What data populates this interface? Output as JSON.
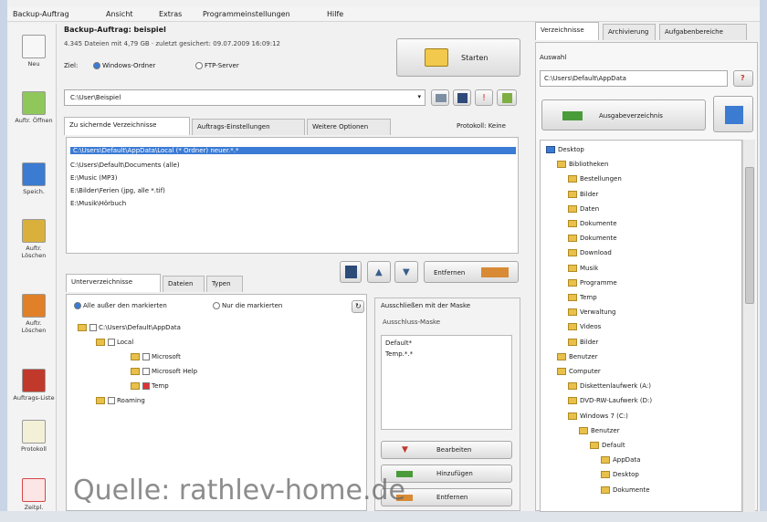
{
  "menu": [
    "Backup-Auftrag",
    "Ansicht",
    "Extras",
    "Programmeinstellungen",
    "Hilfe"
  ],
  "toolbar": [
    {
      "label": "Neu",
      "icon": "new-job-icon",
      "color": "#f2f2f2"
    },
    {
      "label": "Auftr. Öffnen",
      "icon": "open-job-icon",
      "color": "#8fc75b"
    },
    {
      "label": "Speich.",
      "icon": "save-job-icon",
      "color": "#3b7bd1"
    },
    {
      "label": "Auftr. Löschen",
      "icon": "delete-job-icon",
      "color": "#d9b03c"
    },
    {
      "label": "Auftr. Löschen",
      "icon": "remove-job-icon",
      "color": "#e0812a"
    },
    {
      "label": "Auftrags-Liste",
      "icon": "job-list-icon",
      "color": "#c0392b"
    },
    {
      "label": "Protokoll",
      "icon": "protocol-icon",
      "color": "#f4f0d8"
    },
    {
      "label": "Zeitpl.",
      "icon": "schedule-icon",
      "color": "#d8454a"
    }
  ],
  "job": {
    "title": "Backup-Auftrag: beispiel",
    "line2": "4.345 Dateien mit 4,79 GB  ·  zuletzt gesichert: 09.07.2009 16:09:12",
    "ziel_label": "Ziel:",
    "radio1": "Windows-Ordner",
    "radio2": "FTP-Server",
    "start_label": "Starten",
    "path_value": "C:\\User\\Beispiel"
  },
  "main_tabs": [
    "Zu sichernde Verzeichnisse",
    "Auftrags-Einstellungen",
    "Weitere Optionen"
  ],
  "protokoll_label": "Protokoll: Keine",
  "dir_list": [
    "C:\\Users\\Default\\AppData\\Local (* Ordner) neuer.*.*",
    "C:\\Users\\Default\\Documents (alle)",
    "E:\\Music (MP3)",
    "E:\\Bilder\\Ferien (jpg, alle *.tif)",
    "E:\\Musik\\Hörbuch"
  ],
  "actions_label": "Entfernen",
  "sub_tabs": [
    "Unterverzeichnisse",
    "Dateien",
    "Typen"
  ],
  "filter_opt1": "Alle außer den markierten",
  "filter_opt2": "Nur die markierten",
  "tree_left": [
    {
      "text": "C:\\Users\\Default\\AppData",
      "indent": 0
    },
    {
      "text": "Local",
      "indent": 1
    },
    {
      "text": "Microsoft",
      "indent": 2
    },
    {
      "text": "Microsoft Help",
      "indent": 2
    },
    {
      "text": "Temp",
      "indent": 2
    },
    {
      "text": "Roaming",
      "indent": 1
    }
  ],
  "exclude_box": {
    "title": "Ausschließen mit der Maske",
    "subtitle": "Ausschluss-Maske",
    "items": [
      "Default*",
      "Temp.*.*"
    ]
  },
  "exclude_buttons": [
    "Bearbeiten",
    "Hinzufügen",
    "Entfernen"
  ],
  "right_tabs": [
    "Verzeichnisse",
    "Archivierung",
    "Aufgabenbereiche"
  ],
  "right_label": "Auswahl",
  "right_path": "C:\\Users\\Default\\AppData",
  "add_button": "Ausgabeverzeichnis",
  "right_tree": [
    {
      "text": "Desktop",
      "indent": 0
    },
    {
      "text": "Bibliotheken",
      "indent": 1
    },
    {
      "text": "Bestellungen",
      "indent": 2
    },
    {
      "text": "Bilder",
      "indent": 2
    },
    {
      "text": "Daten",
      "indent": 2
    },
    {
      "text": "Dokumente",
      "indent": 2
    },
    {
      "text": "Dokumente",
      "indent": 2
    },
    {
      "text": "Download",
      "indent": 2
    },
    {
      "text": "Musik",
      "indent": 2
    },
    {
      "text": "Programme",
      "indent": 2
    },
    {
      "text": "Temp",
      "indent": 2
    },
    {
      "text": "Verwaltung",
      "indent": 2
    },
    {
      "text": "Videos",
      "indent": 2
    },
    {
      "text": "Bilder",
      "indent": 2
    },
    {
      "text": "Benutzer",
      "indent": 1
    },
    {
      "text": "Computer",
      "indent": 1
    },
    {
      "text": "Diskettenlaufwerk (A:)",
      "indent": 2
    },
    {
      "text": "DVD-RW-Laufwerk (D:)",
      "indent": 2
    },
    {
      "text": "Windows 7 (C:)",
      "indent": 2
    },
    {
      "text": "Benutzer",
      "indent": 3
    },
    {
      "text": "Default",
      "indent": 4
    },
    {
      "text": "AppData",
      "indent": 5
    },
    {
      "text": "Desktop",
      "indent": 5
    },
    {
      "text": "Dokumente",
      "indent": 5
    }
  ],
  "watermark": "Quelle: rathlev-home.de"
}
